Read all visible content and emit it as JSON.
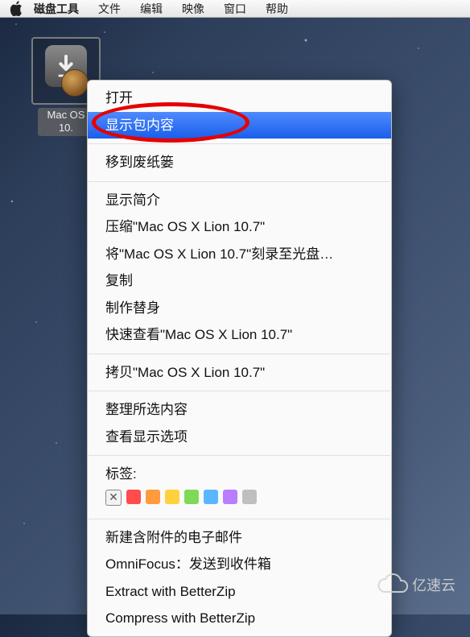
{
  "menubar": {
    "app": "磁盘工具",
    "items": [
      "文件",
      "编辑",
      "映像",
      "窗口",
      "帮助"
    ]
  },
  "desktop_icon": {
    "label_line1": "Mac OS",
    "label_line2": "10."
  },
  "context_menu": {
    "open": "打开",
    "show_package_contents": "显示包内容",
    "move_to_trash": "移到废纸篓",
    "get_info": "显示简介",
    "compress": "压缩\"Mac OS X Lion 10.7\"",
    "burn_to_disc": "将\"Mac OS X Lion 10.7\"刻录至光盘…",
    "duplicate": "复制",
    "make_alias": "制作替身",
    "quick_look": "快速查看\"Mac OS X Lion 10.7\"",
    "copy": "拷贝\"Mac OS X Lion 10.7\"",
    "clean_up_selection": "整理所选内容",
    "show_view_options": "查看显示选项",
    "tags_label": "标签:",
    "tag_colors": [
      "#ff4d4d",
      "#ff9a3d",
      "#ffd23d",
      "#7ed957",
      "#5ab7ff",
      "#b97dff",
      "#bfbfbf"
    ],
    "new_email_with_attachment": "新建含附件的电子邮件",
    "omnifocus_send": "OmniFocus：发送到收件箱",
    "betterzip_extract": "Extract with BetterZip",
    "betterzip_compress": "Compress with BetterZip"
  },
  "watermark": {
    "text": "亿速云"
  }
}
